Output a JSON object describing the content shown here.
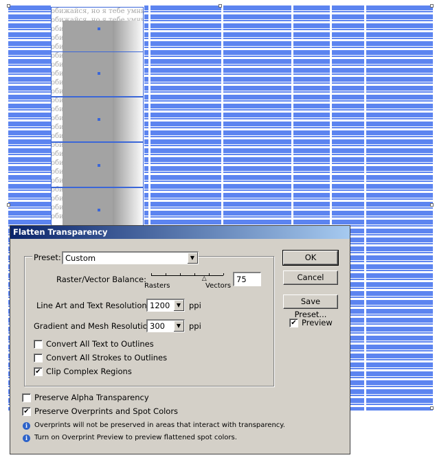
{
  "background": {
    "russian_text": "обижайся, но я тебе умный"
  },
  "dialog": {
    "title": "Flatten Transparency",
    "preset": {
      "label": "Preset:",
      "value": "Custom"
    },
    "raster_vector": {
      "label": "Raster/Vector Balance:",
      "left_label": "Rasters",
      "right_label": "Vectors",
      "value": "75",
      "slider_fraction": 0.75
    },
    "line_art": {
      "label": "Line Art and Text Resolution:",
      "value": "1200",
      "unit": "ppi"
    },
    "gradient": {
      "label": "Gradient and Mesh Resolution:",
      "value": "300",
      "unit": "ppi"
    },
    "checks": {
      "text_outlines": {
        "label": "Convert All Text to Outlines",
        "checked": false
      },
      "stroke_outlines": {
        "label": "Convert All Strokes to Outlines",
        "checked": false
      },
      "clip_complex": {
        "label": "Clip Complex Regions",
        "checked": true
      },
      "preserve_alpha": {
        "label": "Preserve Alpha Transparency",
        "checked": false
      },
      "preserve_overprints": {
        "label": "Preserve Overprints and Spot Colors",
        "checked": true
      },
      "preview": {
        "label": "Preview",
        "checked": true
      }
    },
    "buttons": {
      "ok": "OK",
      "cancel": "Cancel",
      "save_preset": "Save Preset..."
    },
    "info": {
      "line1": "Overprints will not be preserved in areas that interact with transparency.",
      "line2": "Turn on Overprint Preview to preview flattened spot colors."
    },
    "check_mark": "✔",
    "dropdown_glyph": "▼",
    "info_glyph": "i",
    "thumb_glyph": "△"
  }
}
